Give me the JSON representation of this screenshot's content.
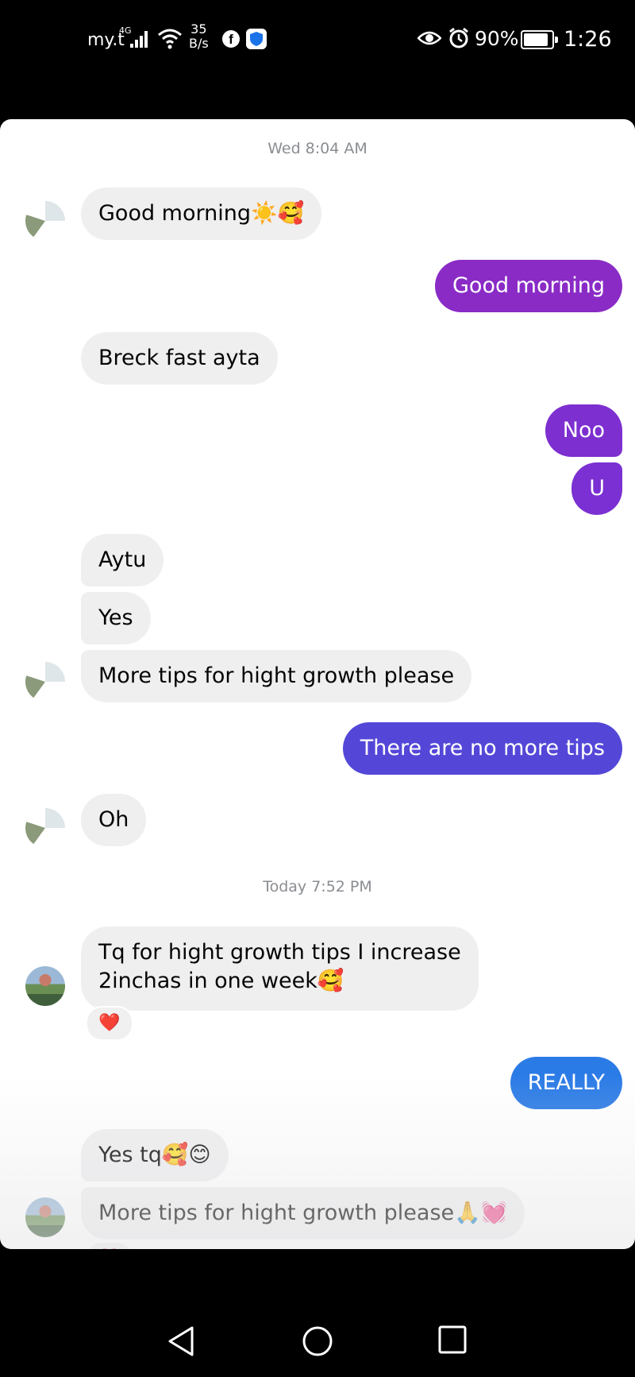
{
  "status_bar": {
    "carrier": "my.t",
    "network": "4G",
    "speed_value": "35",
    "speed_unit": "B/s",
    "battery": "90%",
    "time": "1:26"
  },
  "chat": {
    "timestamps": [
      "Wed 8:04 AM",
      "Today 7:52 PM"
    ],
    "messages": [
      {
        "dir": "in",
        "text": "Good morning☀️🥰"
      },
      {
        "dir": "out",
        "text": "Good morning",
        "color": "#8a2bc6"
      },
      {
        "dir": "in",
        "text": "Breck fast ayta"
      },
      {
        "dir": "out",
        "text": "Noo",
        "color": "#7d2fd0"
      },
      {
        "dir": "out",
        "text": "U",
        "color": "#7a30d2"
      },
      {
        "dir": "in",
        "text": "Aytu"
      },
      {
        "dir": "in",
        "text": "Yes"
      },
      {
        "dir": "in",
        "text": "More tips for hight growth please"
      },
      {
        "dir": "out",
        "text": "There are no more tips",
        "color": "#5447d8"
      },
      {
        "dir": "in",
        "text": "Oh"
      },
      {
        "dir": "in",
        "text_line1": "Tq for hight growth tips I increase",
        "text_line2": "2inchas in one week🥰",
        "reaction": "❤️"
      },
      {
        "dir": "out",
        "text": "REALLY",
        "color": "#2b7be6"
      },
      {
        "dir": "in",
        "text": "Yes tq🥰😊"
      },
      {
        "dir": "in",
        "text": "More tips for hight growth please🙏💓",
        "reaction": "❤️"
      }
    ]
  },
  "nav_bar": {
    "back_icon": "triangle-back-icon",
    "home_icon": "circle-home-icon",
    "recents_icon": "square-recents-icon"
  }
}
